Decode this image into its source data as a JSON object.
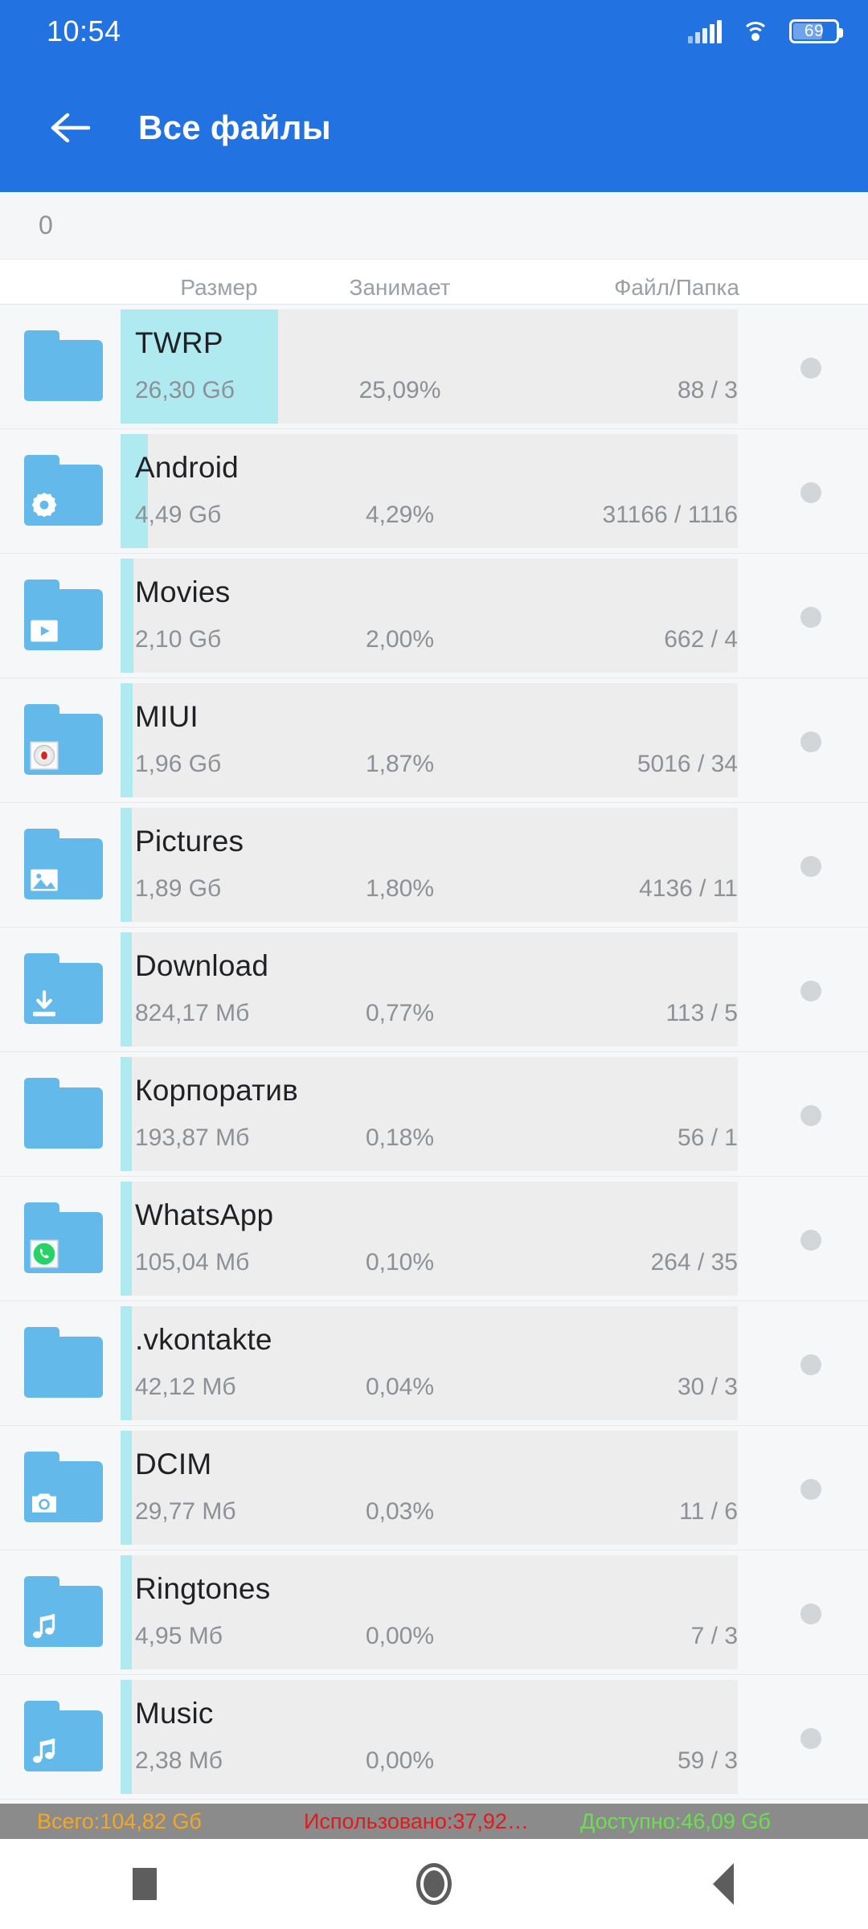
{
  "statusbar": {
    "clock": "10:54",
    "battery_percent": "69",
    "signal_icon": "signal-bars-icon",
    "wifi_icon": "wifi-icon",
    "battery_icon": "battery-icon"
  },
  "appbar": {
    "back_icon": "back-arrow-icon",
    "title": "Все файлы"
  },
  "breadcrumb": {
    "path": "0"
  },
  "columns": {
    "size": "Размер",
    "percent": "Занимает",
    "count": "Файл/Папка"
  },
  "rows": [
    {
      "name": "TWRP",
      "size": "26,30 Gб",
      "percent": "25,09%",
      "count": "88 / 3",
      "bar_pct": 25.09,
      "icon": "folder-icon"
    },
    {
      "name": "Android",
      "size": "4,49 Gб",
      "percent": "4,29%",
      "count": "31166 / 1116",
      "bar_pct": 4.29,
      "icon": "folder-gear-icon"
    },
    {
      "name": "Movies",
      "size": "2,10 Gб",
      "percent": "2,00%",
      "count": "662 / 4",
      "bar_pct": 2.0,
      "icon": "folder-video-icon"
    },
    {
      "name": "MIUI",
      "size": "1,96 Gб",
      "percent": "1,87%",
      "count": "5016 / 34",
      "bar_pct": 1.87,
      "icon": "folder-recorder-icon"
    },
    {
      "name": "Pictures",
      "size": "1,89 Gб",
      "percent": "1,80%",
      "count": "4136 / 11",
      "bar_pct": 1.8,
      "icon": "folder-image-icon"
    },
    {
      "name": "Download",
      "size": "824,17 Mб",
      "percent": "0,77%",
      "count": "113 / 5",
      "bar_pct": 0.77,
      "icon": "folder-download-icon"
    },
    {
      "name": "Корпоратив",
      "size": "193,87 Mб",
      "percent": "0,18%",
      "count": "56 / 1",
      "bar_pct": 0.18,
      "icon": "folder-icon"
    },
    {
      "name": "WhatsApp",
      "size": "105,04 Mб",
      "percent": "0,10%",
      "count": "264 / 35",
      "bar_pct": 0.1,
      "icon": "folder-whatsapp-icon"
    },
    {
      "name": ".vkontakte",
      "size": "42,12 Mб",
      "percent": "0,04%",
      "count": "30 / 3",
      "bar_pct": 0.04,
      "icon": "folder-icon"
    },
    {
      "name": "DCIM",
      "size": "29,77 Mб",
      "percent": "0,03%",
      "count": "11 / 6",
      "bar_pct": 0.03,
      "icon": "folder-camera-icon"
    },
    {
      "name": "Ringtones",
      "size": "4,95 Mб",
      "percent": "0,00%",
      "count": "7 / 3",
      "bar_pct": 0.0,
      "icon": "folder-music-icon"
    },
    {
      "name": "Music",
      "size": "2,38 Mб",
      "percent": "0,00%",
      "count": "59 / 3",
      "bar_pct": 0.0,
      "icon": "folder-music-icon"
    }
  ],
  "summary": {
    "total": "Всего:104,82 Gб",
    "used": "Использовано:37,92…",
    "free": "Доступно:46,09 Gб",
    "total_color": "#F5A623",
    "used_color": "#E01B1B",
    "free_color": "#6BE04F"
  },
  "navbar": {
    "recents_icon": "recents-square-icon",
    "home_icon": "home-circle-icon",
    "back_icon": "back-triangle-icon"
  },
  "theme": {
    "header_blue": "#2372E2",
    "folder_blue": "#63B9EA",
    "bar_cyan": "#AEEAF0",
    "row_gray": "#ededed"
  }
}
